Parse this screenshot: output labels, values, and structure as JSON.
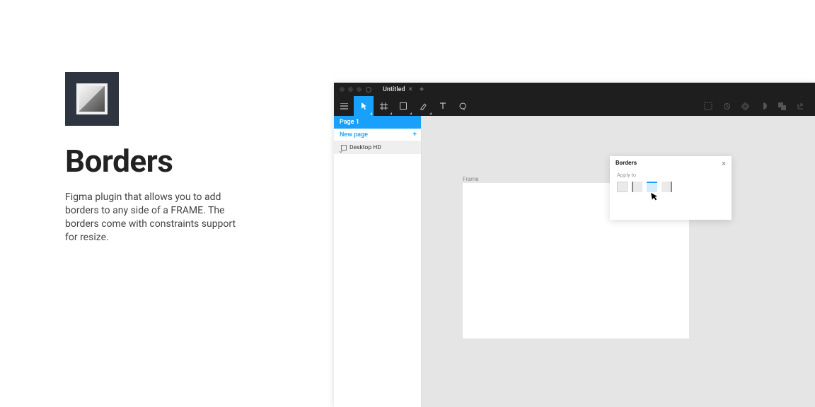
{
  "plugin": {
    "title": "Borders",
    "description": "Figma plugin that allows you to add borders to any side of a FRAME. The borders come with constraints support for resize."
  },
  "window": {
    "title": "Untitled"
  },
  "pages": {
    "current": "Page 1",
    "newPageLabel": "New page"
  },
  "layers": {
    "root": "Desktop HD"
  },
  "canvas": {
    "frameLabel": "Frame"
  },
  "panel": {
    "title": "Borders",
    "applyToLabel": "Apply to"
  }
}
